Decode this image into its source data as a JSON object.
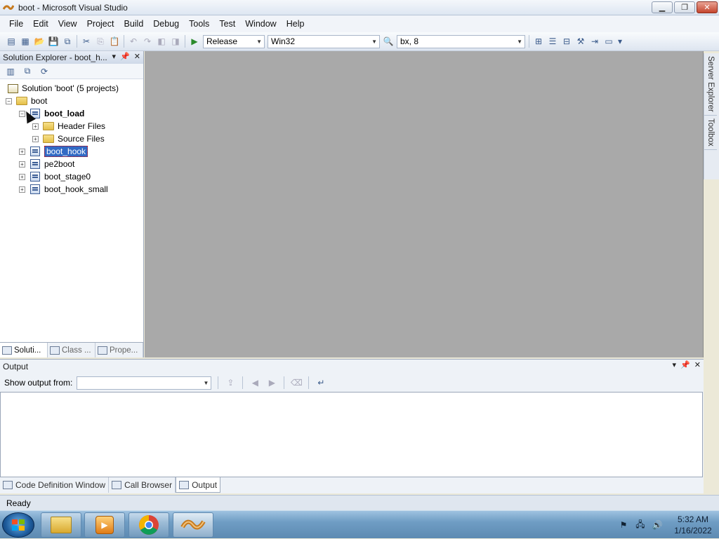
{
  "window": {
    "title": "boot - Microsoft Visual Studio",
    "controls": [
      "minimize-icon",
      "restore-icon",
      "close-icon"
    ]
  },
  "menu": [
    "File",
    "Edit",
    "View",
    "Project",
    "Build",
    "Debug",
    "Tools",
    "Test",
    "Window",
    "Help"
  ],
  "toolbar": {
    "configuration": "Release",
    "platform": "Win32",
    "find_value": "bx, 8"
  },
  "side_tabs": [
    "Server Explorer",
    "Toolbox"
  ],
  "solution_explorer": {
    "title": "Solution Explorer - boot_h...",
    "tree": {
      "solution": "Solution 'boot' (5 projects)",
      "folder": "boot",
      "projects": [
        {
          "name": "boot_load",
          "expanded": true,
          "children": [
            "Header Files",
            "Source Files"
          ]
        },
        {
          "name": "boot_hook",
          "selected": true
        },
        {
          "name": "pe2boot"
        },
        {
          "name": "boot_stage0"
        },
        {
          "name": "boot_hook_small"
        }
      ]
    },
    "bottom_tabs": [
      "Soluti...",
      "Class ...",
      "Prope..."
    ]
  },
  "output": {
    "title": "Output",
    "show_label": "Show output from:",
    "show_value": "",
    "tabs": [
      "Code Definition Window",
      "Call Browser",
      "Output"
    ],
    "active_tab": "Output"
  },
  "status": "Ready",
  "taskbar": {
    "time": "5:32 AM",
    "date": "1/16/2022"
  }
}
